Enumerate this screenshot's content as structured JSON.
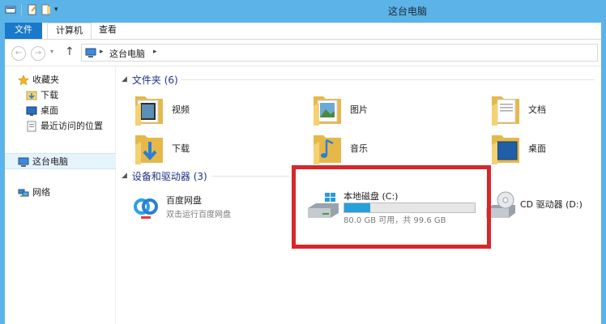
{
  "window": {
    "title": "这台电脑"
  },
  "ribbon": {
    "tabs": [
      {
        "label": "文件"
      },
      {
        "label": "计算机"
      },
      {
        "label": "查看"
      }
    ]
  },
  "address": {
    "path": "这台电脑"
  },
  "sidebar": {
    "items": [
      {
        "label": "收藏夹"
      },
      {
        "label": "下载"
      },
      {
        "label": "桌面"
      },
      {
        "label": "最近访问的位置"
      },
      {
        "label": "这台电脑"
      },
      {
        "label": "网络"
      }
    ]
  },
  "folders_group": {
    "title": "文件夹 (6)",
    "items": [
      {
        "label": "视频"
      },
      {
        "label": "图片"
      },
      {
        "label": "文档"
      },
      {
        "label": "下载"
      },
      {
        "label": "音乐"
      },
      {
        "label": "桌面"
      }
    ]
  },
  "devices_group": {
    "title": "设备和驱动器 (3)",
    "items": [
      {
        "label": "百度网盘",
        "sub": "双击运行百度网盘"
      },
      {
        "label": "本地磁盘 (C:)",
        "sub": "80.0 GB 可用，共 99.6 GB",
        "used_fraction": 0.197
      },
      {
        "label": "CD 驱动器 (D:)"
      }
    ]
  },
  "colors": {
    "accent": "#5cb3e8",
    "file_tab": "#1979ca",
    "highlight": "#d8262b",
    "usage_bar": "#26a0da"
  }
}
